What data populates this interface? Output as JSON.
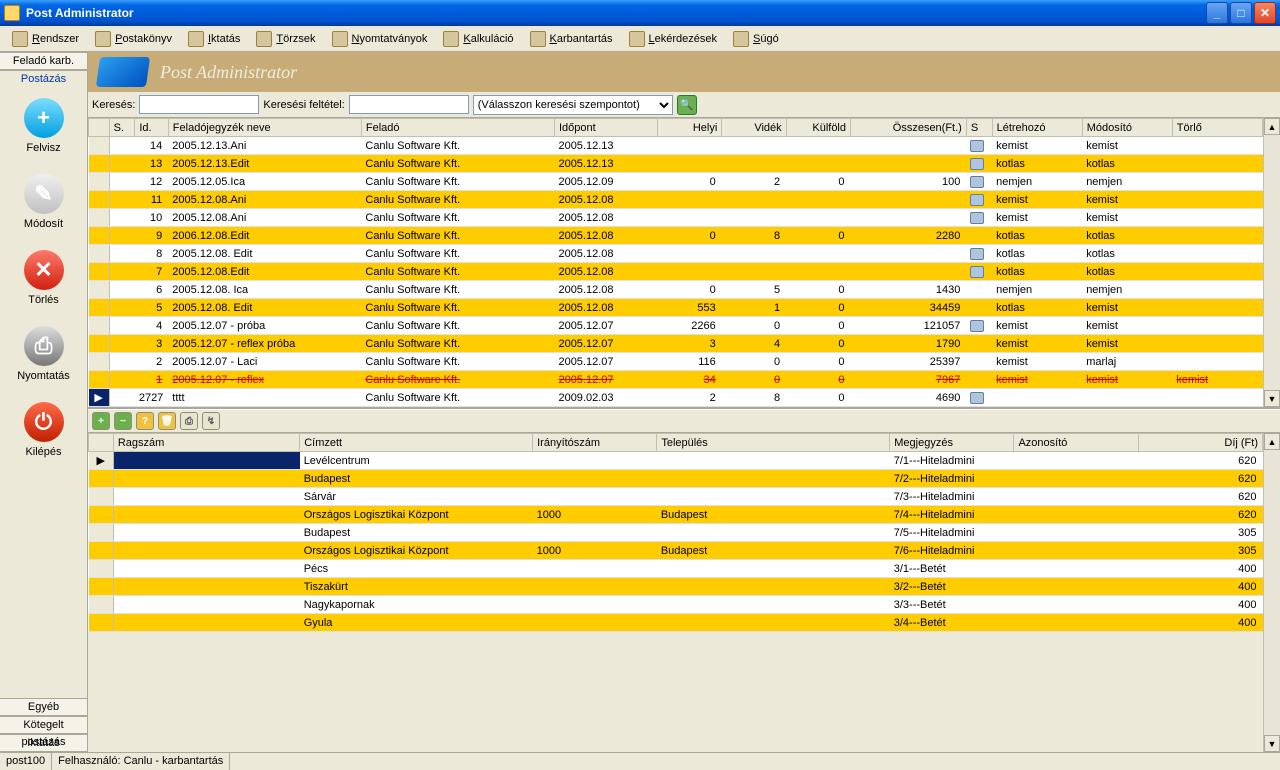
{
  "title": "Post Administrator",
  "menu": [
    "Rendszer",
    "Postakönyv",
    "Iktatás",
    "Törzsek",
    "Nyomtatványok",
    "Kalkuláció",
    "Karbantartás",
    "Lekérdezések",
    "Súgó"
  ],
  "sidebar": {
    "tabs": [
      "Feladó karb.",
      "Postázás"
    ],
    "active_tab": 1,
    "tools": [
      {
        "label": "Felvisz",
        "cls": "add",
        "sym": "+"
      },
      {
        "label": "Módosít",
        "cls": "edit",
        "sym": "✎"
      },
      {
        "label": "Törlés",
        "cls": "del",
        "sym": "✕"
      },
      {
        "label": "Nyomtatás",
        "cls": "prn",
        "sym": "⎙"
      },
      {
        "label": "Kilépés",
        "cls": "exit",
        "sym": "⏻"
      }
    ],
    "bottom": [
      "Egyéb",
      "Kötegelt postázás",
      "Iktatás"
    ]
  },
  "banner": "Post Administrator",
  "search": {
    "label1": "Keresés:",
    "label2": "Keresési feltétel:",
    "combo": "(Válasszon keresési szempontot)"
  },
  "grid1": {
    "cols": [
      "",
      "S.",
      "Id.",
      "Feladójegyzék neve",
      "Feladó",
      "Időpont",
      "Helyi",
      "Vidék",
      "Külföld",
      "Összesen(Ft.)",
      "S",
      "Létrehozó",
      "Módosító",
      "Törlő"
    ],
    "rows": [
      {
        "hl": false,
        "id": "14",
        "nev": "2005.12.13.Ani",
        "felado": "Canlu Software Kft.",
        "ido": "2005.12.13",
        "he": "",
        "vi": "",
        "ku": "",
        "sum": "",
        "ic": true,
        "l": "kemist",
        "m": "kemist",
        "t": ""
      },
      {
        "hl": true,
        "id": "13",
        "nev": "2005.12.13.Edit",
        "felado": "Canlu Software Kft.",
        "ido": "2005.12.13",
        "he": "",
        "vi": "",
        "ku": "",
        "sum": "",
        "ic": true,
        "l": "kotlas",
        "m": "kotlas",
        "t": ""
      },
      {
        "hl": false,
        "id": "12",
        "nev": "2005.12.05.Ica",
        "felado": "Canlu Software Kft.",
        "ido": "2005.12.09",
        "he": "0",
        "vi": "2",
        "ku": "0",
        "sum": "100",
        "ic": true,
        "l": "nemjen",
        "m": "nemjen",
        "t": ""
      },
      {
        "hl": true,
        "id": "11",
        "nev": "2005.12.08.Ani",
        "felado": "Canlu Software Kft.",
        "ido": "2005.12.08",
        "he": "",
        "vi": "",
        "ku": "",
        "sum": "",
        "ic": true,
        "l": "kemist",
        "m": "kemist",
        "t": ""
      },
      {
        "hl": false,
        "id": "10",
        "nev": "2005.12.08.Ani",
        "felado": "Canlu Software Kft.",
        "ido": "2005.12.08",
        "he": "",
        "vi": "",
        "ku": "",
        "sum": "",
        "ic": true,
        "l": "kemist",
        "m": "kemist",
        "t": ""
      },
      {
        "hl": true,
        "id": "9",
        "nev": "2006.12.08.Edit",
        "felado": "Canlu Software Kft.",
        "ido": "2005.12.08",
        "he": "0",
        "vi": "8",
        "ku": "0",
        "sum": "2280",
        "ic": false,
        "l": "kotlas",
        "m": "kotlas",
        "t": ""
      },
      {
        "hl": false,
        "id": "8",
        "nev": "2005.12.08. Edit",
        "felado": "Canlu Software Kft.",
        "ido": "2005.12.08",
        "he": "",
        "vi": "",
        "ku": "",
        "sum": "",
        "ic": true,
        "l": "kotlas",
        "m": "kotlas",
        "t": ""
      },
      {
        "hl": true,
        "id": "7",
        "nev": "2005.12.08.Edit",
        "felado": "Canlu Software Kft.",
        "ido": "2005.12.08",
        "he": "",
        "vi": "",
        "ku": "",
        "sum": "",
        "ic": true,
        "l": "kotlas",
        "m": "kotlas",
        "t": ""
      },
      {
        "hl": false,
        "id": "6",
        "nev": "2005.12.08. Ica",
        "felado": "Canlu Software Kft.",
        "ido": "2005.12.08",
        "he": "0",
        "vi": "5",
        "ku": "0",
        "sum": "1430",
        "ic": false,
        "l": "nemjen",
        "m": "nemjen",
        "t": ""
      },
      {
        "hl": true,
        "id": "5",
        "nev": "2005.12.08. Edit",
        "felado": "Canlu Software Kft.",
        "ido": "2005.12.08",
        "he": "553",
        "vi": "1",
        "ku": "0",
        "sum": "34459",
        "ic": false,
        "l": "kotlas",
        "m": "kemist",
        "t": ""
      },
      {
        "hl": false,
        "id": "4",
        "nev": "2005.12.07 - próba",
        "felado": "Canlu Software Kft.",
        "ido": "2005.12.07",
        "he": "2266",
        "vi": "0",
        "ku": "0",
        "sum": "121057",
        "ic": true,
        "l": "kemist",
        "m": "kemist",
        "t": ""
      },
      {
        "hl": true,
        "id": "3",
        "nev": "2005.12.07 - reflex próba",
        "felado": "Canlu Software Kft.",
        "ido": "2005.12.07",
        "he": "3",
        "vi": "4",
        "ku": "0",
        "sum": "1790",
        "ic": false,
        "l": "kemist",
        "m": "kemist",
        "t": ""
      },
      {
        "hl": false,
        "id": "2",
        "nev": "2005.12.07 - Laci",
        "felado": "Canlu Software Kft.",
        "ido": "2005.12.07",
        "he": "116",
        "vi": "0",
        "ku": "0",
        "sum": "25397",
        "ic": false,
        "l": "kemist",
        "m": "marlaj",
        "t": ""
      },
      {
        "struck": true,
        "id": "1",
        "nev": "2005.12.07 - reflex",
        "felado": "Canlu Software Kft.",
        "ido": "2005.12.07",
        "he": "34",
        "vi": "0",
        "ku": "0",
        "sum": "7967",
        "ic": false,
        "l": "kemist",
        "m": "kemist",
        "t": "kemist"
      },
      {
        "sel": true,
        "id": "2727",
        "nev": "tttt",
        "felado": "Canlu Software Kft.",
        "ido": "2009.02.03",
        "he": "2",
        "vi": "8",
        "ku": "0",
        "sum": "4690",
        "ic": true,
        "l": "",
        "m": "",
        "t": ""
      }
    ]
  },
  "grid2": {
    "cols": [
      "",
      "Ragszám",
      "Címzett",
      "Irányítószám",
      "Település",
      "Megjegyzés",
      "Azonosító",
      "Díj (Ft)"
    ],
    "rows": [
      {
        "sel": true,
        "rag": "",
        "cim": "Levélcentrum",
        "ir": "",
        "tel": "",
        "meg": "7/1---Hiteladmini",
        "az": "",
        "dij": "620"
      },
      {
        "hl": true,
        "rag": "",
        "cim": "Budapest",
        "ir": "",
        "tel": "",
        "meg": "7/2---Hiteladmini",
        "az": "",
        "dij": "620"
      },
      {
        "hl": false,
        "rag": "",
        "cim": "Sárvár",
        "ir": "",
        "tel": "",
        "meg": "7/3---Hiteladmini",
        "az": "",
        "dij": "620"
      },
      {
        "hl": true,
        "rag": "",
        "cim": "Országos Logisztikai Központ",
        "ir": "1000",
        "tel": "Budapest",
        "meg": "7/4---Hiteladmini",
        "az": "",
        "dij": "620"
      },
      {
        "hl": false,
        "rag": "",
        "cim": "Budapest",
        "ir": "",
        "tel": "",
        "meg": "7/5---Hiteladmini",
        "az": "",
        "dij": "305"
      },
      {
        "hl": true,
        "rag": "",
        "cim": "Országos Logisztikai Központ",
        "ir": "1000",
        "tel": "Budapest",
        "meg": "7/6---Hiteladmini",
        "az": "",
        "dij": "305"
      },
      {
        "hl": false,
        "rag": "",
        "cim": "Pécs",
        "ir": "",
        "tel": "",
        "meg": "3/1---Betét",
        "az": "",
        "dij": "400"
      },
      {
        "hl": true,
        "rag": "",
        "cim": "Tiszakürt",
        "ir": "",
        "tel": "",
        "meg": "3/2---Betét",
        "az": "",
        "dij": "400"
      },
      {
        "hl": false,
        "rag": "",
        "cim": "Nagykapornak",
        "ir": "",
        "tel": "",
        "meg": "3/3---Betét",
        "az": "",
        "dij": "400"
      },
      {
        "hl": true,
        "rag": "",
        "cim": "Gyula",
        "ir": "",
        "tel": "",
        "meg": "3/4---Betét",
        "az": "",
        "dij": "400"
      }
    ]
  },
  "status": {
    "left": "post100",
    "right": "Felhasználó: Canlu - karbantartás"
  }
}
